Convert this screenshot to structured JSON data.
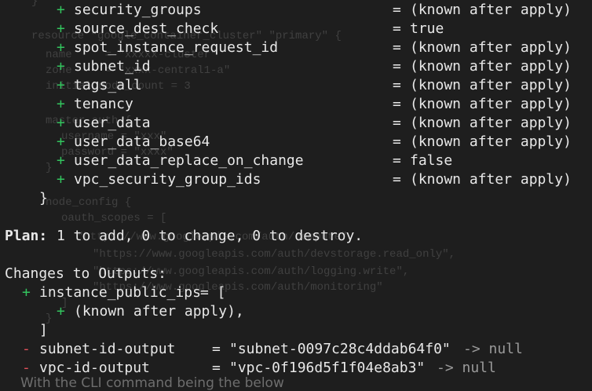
{
  "background_code": [
    "}",
    "resource \"google_container_cluster\" \"primary\" {",
    "name     = \"xxxxx-cluster\"",
    "zone     = \"xxxx-central1-a\"",
    "initial_node_count = 3",
    "master_auth {",
    "username = \"xxx\"",
    "password = \"xxxx\"",
    "}",
    "node_config {",
    "oauth_scopes = [",
    "\"https://www.googleapis.com/auth/compute\",",
    "\"https://www.googleapis.com/auth/devstorage.read_only\",",
    "\"https://www.googleapis.com/auth/logging.write\",",
    "\"https://www.googleapis.com/auth/monitoring\"",
    "]",
    "}"
  ],
  "resource_attributes": [
    {
      "sign": "+",
      "name": "security_groups",
      "value": "(known after apply)"
    },
    {
      "sign": "+",
      "name": "source_dest_check",
      "value": "true"
    },
    {
      "sign": "+",
      "name": "spot_instance_request_id",
      "value": "(known after apply)"
    },
    {
      "sign": "+",
      "name": "subnet_id",
      "value": "(known after apply)"
    },
    {
      "sign": "+",
      "name": "tags_all",
      "value": "(known after apply)"
    },
    {
      "sign": "+",
      "name": "tenancy",
      "value": "(known after apply)"
    },
    {
      "sign": "+",
      "name": "user_data",
      "value": "(known after apply)"
    },
    {
      "sign": "+",
      "name": "user_data_base64",
      "value": "(known after apply)"
    },
    {
      "sign": "+",
      "name": "user_data_replace_on_change",
      "value": "false"
    },
    {
      "sign": "+",
      "name": "vpc_security_group_ids",
      "value": "(known after apply)"
    }
  ],
  "closing_brace": "}",
  "plan": {
    "label": "Plan:",
    "text": "1 to add, 0 to change, 0 to destroy."
  },
  "outputs": {
    "header": "Changes to Outputs:",
    "added": {
      "sign": "+",
      "name": "instance_public_ips",
      "value": "= ["
    },
    "added_item": {
      "sign": "+",
      "value": "(known after apply),"
    },
    "added_close": "]",
    "removed": [
      {
        "sign": "-",
        "name": "subnet-id-output",
        "value": "\"subnet-0097c28c4ddab64f0\"",
        "arrow": "-> null"
      },
      {
        "sign": "-",
        "name": "vpc-id-output",
        "value": "\"vpc-0f196d5f1f04e8ab3\"",
        "arrow": "-> null"
      }
    ]
  },
  "caption": "With the CLI command being the below",
  "colors": {
    "background": "#1e1e1e",
    "add": "#33c45e",
    "remove": "#e0505a",
    "text": "#e8e8e8"
  }
}
